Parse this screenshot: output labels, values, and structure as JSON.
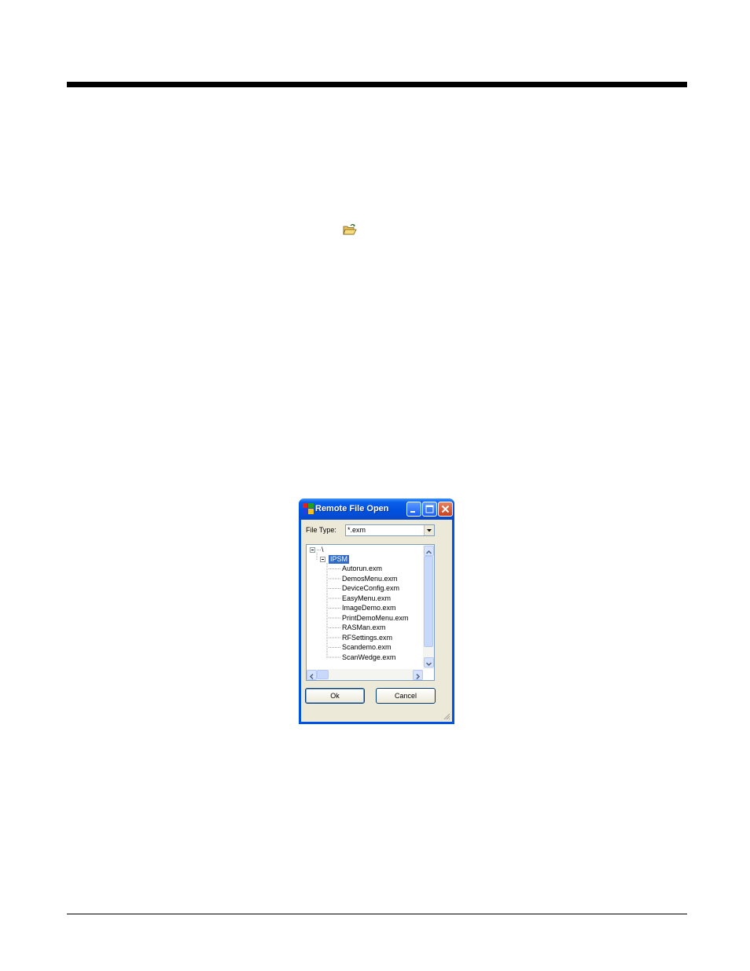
{
  "dialog": {
    "title": "Remote File Open",
    "file_type_label": "File Type:",
    "file_type_value": "*.exm",
    "tree": {
      "root": "\\",
      "folder": "IPSM",
      "files": [
        "Autorun.exm",
        "DemosMenu.exm",
        "DeviceConfig.exm",
        "EasyMenu.exm",
        "ImageDemo.exm",
        "PrintDemoMenu.exm",
        "RASMan.exm",
        "RFSettings.exm",
        "Scandemo.exm",
        "ScanWedge.exm"
      ]
    },
    "ok_label": "Ok",
    "cancel_label": "Cancel"
  },
  "icons": {
    "open_folder": "open-folder-icon",
    "app": "app-icon",
    "minimize": "minimize-icon",
    "maximize": "maximize-icon",
    "close": "close-icon"
  },
  "colors": {
    "titlebar": "#0054e3",
    "selection": "#316ac5",
    "client": "#ece9d8"
  }
}
